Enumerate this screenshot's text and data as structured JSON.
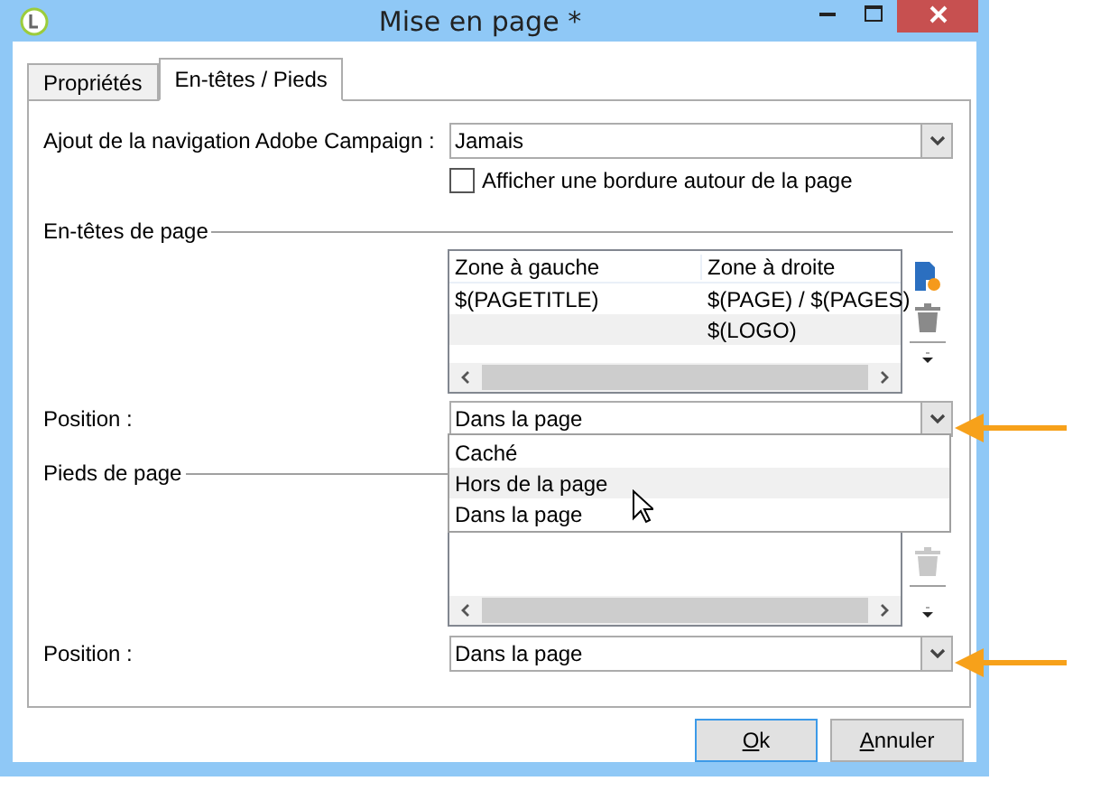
{
  "window": {
    "title": "Mise en page *"
  },
  "tabs": [
    {
      "label": "Propriétés",
      "selected": false
    },
    {
      "label": "En-têtes / Pieds",
      "selected": true
    }
  ],
  "navigation": {
    "label": "Ajout de la navigation Adobe Campaign :",
    "value": "Jamais"
  },
  "border_option": {
    "label": "Afficher une bordure autour de la page",
    "checked": false
  },
  "headers": {
    "title": "En-têtes de page",
    "columns": [
      "Zone à gauche",
      "Zone à droite"
    ],
    "rows": [
      [
        "$(PAGETITLE)",
        "$(PAGE) / $(PAGES)"
      ],
      [
        "",
        "$(LOGO)"
      ]
    ],
    "position_label": "Position :",
    "position_value": "Dans la page"
  },
  "position_options": [
    {
      "label": "Caché",
      "selected": false
    },
    {
      "label": "Hors de la page",
      "selected": true
    },
    {
      "label": "Dans la page",
      "selected": false
    }
  ],
  "footers": {
    "title": "Pieds de page",
    "position_label": "Position :",
    "position_value": "Dans la page"
  },
  "buttons": [
    {
      "label": "Ok",
      "default": true
    },
    {
      "label": "Annuler",
      "default": false
    }
  ]
}
